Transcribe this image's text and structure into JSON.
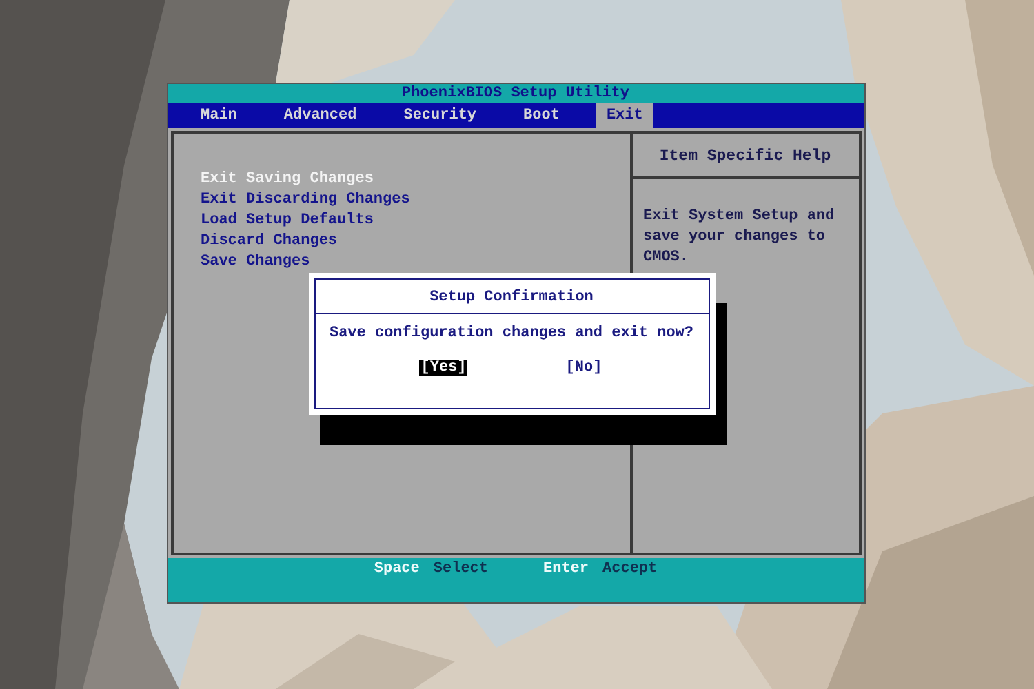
{
  "window": {
    "title": "PhoenixBIOS Setup Utility"
  },
  "tabs": [
    {
      "label": "Main",
      "selected": false
    },
    {
      "label": "Advanced",
      "selected": false
    },
    {
      "label": "Security",
      "selected": false
    },
    {
      "label": "Boot",
      "selected": false
    },
    {
      "label": "Exit",
      "selected": true
    }
  ],
  "menu_items": [
    {
      "label": "Exit Saving Changes",
      "selected": true
    },
    {
      "label": "Exit Discarding Changes",
      "selected": false
    },
    {
      "label": "Load Setup Defaults",
      "selected": false
    },
    {
      "label": "Discard Changes",
      "selected": false
    },
    {
      "label": "Save Changes",
      "selected": false
    }
  ],
  "help": {
    "title": "Item Specific Help",
    "text": "Exit System Setup and save your changes to CMOS."
  },
  "dialog": {
    "title": "Setup Confirmation",
    "message": "Save configuration changes and exit now?",
    "buttons": [
      {
        "label": "[Yes]",
        "selected": true
      },
      {
        "label": "[No]",
        "selected": false
      }
    ]
  },
  "status_bar": [
    {
      "key": "Space",
      "action": "Select"
    },
    {
      "key": "Enter",
      "action": "Accept"
    }
  ]
}
